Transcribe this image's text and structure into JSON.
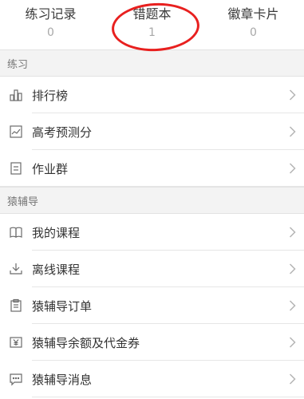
{
  "stats": [
    {
      "label": "练习记录",
      "value": "0"
    },
    {
      "label": "错题本",
      "value": "1"
    },
    {
      "label": "徽章卡片",
      "value": "0"
    }
  ],
  "annotation_color": "#e8201f",
  "sections": [
    {
      "header": "练习",
      "items": [
        {
          "label": "排行榜",
          "icon": "bar-chart-icon"
        },
        {
          "label": "高考预测分",
          "icon": "trend-chart-icon"
        },
        {
          "label": "作业群",
          "icon": "document-icon"
        }
      ]
    },
    {
      "header": "猿辅导",
      "items": [
        {
          "label": "我的课程",
          "icon": "book-icon"
        },
        {
          "label": "离线课程",
          "icon": "download-icon"
        },
        {
          "label": "猿辅导订单",
          "icon": "clipboard-icon"
        },
        {
          "label": "猿辅导余额及代金券",
          "icon": "yen-icon"
        },
        {
          "label": "猿辅导消息",
          "icon": "message-icon"
        }
      ]
    }
  ]
}
